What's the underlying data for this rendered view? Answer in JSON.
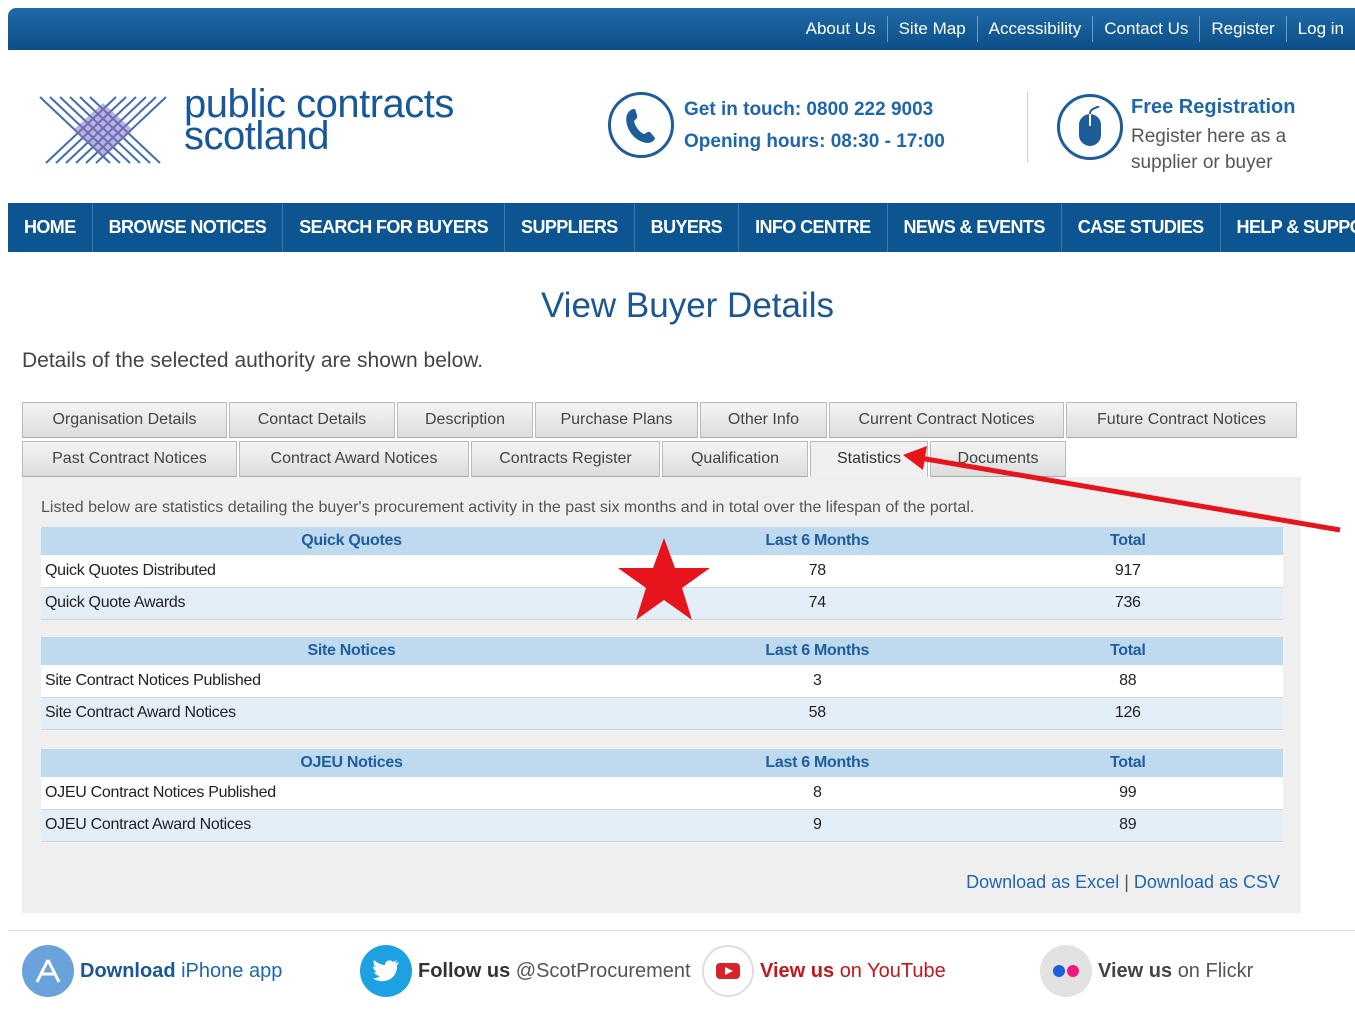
{
  "toplinks": [
    "About Us",
    "Site Map",
    "Accessibility",
    "Contact Us",
    "Register",
    "Log in"
  ],
  "logo": {
    "line1": "public contracts",
    "line2": "scotland"
  },
  "contact": {
    "line1": "Get in touch: 0800 222 9003",
    "line2": "Opening hours: 08:30 - 17:00"
  },
  "registration": {
    "title": "Free Registration",
    "subtitle": "Register here as a supplier or buyer"
  },
  "nav": [
    "HOME",
    "BROWSE NOTICES",
    "SEARCH FOR BUYERS",
    "SUPPLIERS",
    "BUYERS",
    "INFO CENTRE",
    "NEWS & EVENTS",
    "CASE STUDIES",
    "HELP & SUPPORT"
  ],
  "page": {
    "title": "View Buyer Details",
    "intro": "Details of the selected authority are shown below."
  },
  "tabs_row1": [
    "Organisation Details",
    "Contact Details",
    "Description",
    "Purchase Plans",
    "Other Info",
    "Current Contract Notices",
    "Future Contract Notices"
  ],
  "tabs_row2": [
    "Past Contract Notices",
    "Contract Award Notices",
    "Contracts Register",
    "Qualification",
    "Statistics",
    "Documents"
  ],
  "active_tab": "Statistics",
  "statistics": {
    "intro": "Listed below are statistics detailing the buyer's procurement activity in the past six months and in total over the lifespan of the portal.",
    "sections": [
      {
        "heading": "Quick Quotes",
        "col2": "Last 6 Months",
        "col3": "Total",
        "rows": [
          {
            "label": "Quick Quotes Distributed",
            "last6": "78",
            "total": "917"
          },
          {
            "label": "Quick Quote Awards",
            "last6": "74",
            "total": "736"
          }
        ]
      },
      {
        "heading": "Site Notices",
        "col2": "Last 6 Months",
        "col3": "Total",
        "rows": [
          {
            "label": "Site Contract Notices Published",
            "last6": "3",
            "total": "88"
          },
          {
            "label": "Site Contract Award Notices",
            "last6": "58",
            "total": "126"
          }
        ]
      },
      {
        "heading": "OJEU Notices",
        "col2": "Last 6 Months",
        "col3": "Total",
        "rows": [
          {
            "label": "OJEU Contract Notices Published",
            "last6": "8",
            "total": "99"
          },
          {
            "label": "OJEU Contract Award Notices",
            "last6": "9",
            "total": "89"
          }
        ]
      }
    ],
    "download_excel": "Download as Excel",
    "separator": "|",
    "download_csv": "Download as CSV"
  },
  "footer": [
    {
      "strong": "Download",
      "rest": "iPhone app",
      "icon": "app-store-icon"
    },
    {
      "strong": "Follow us",
      "rest": "@ScotProcurement",
      "icon": "twitter-icon"
    },
    {
      "strong": "View us",
      "rest": "on YouTube",
      "icon": "youtube-icon"
    },
    {
      "strong": "View us",
      "rest": "on Flickr",
      "icon": "flickr-icon"
    }
  ],
  "colors": {
    "brand_blue": "#0d5590",
    "link_blue": "#1e67ac",
    "annotation_red": "#e8141b"
  }
}
